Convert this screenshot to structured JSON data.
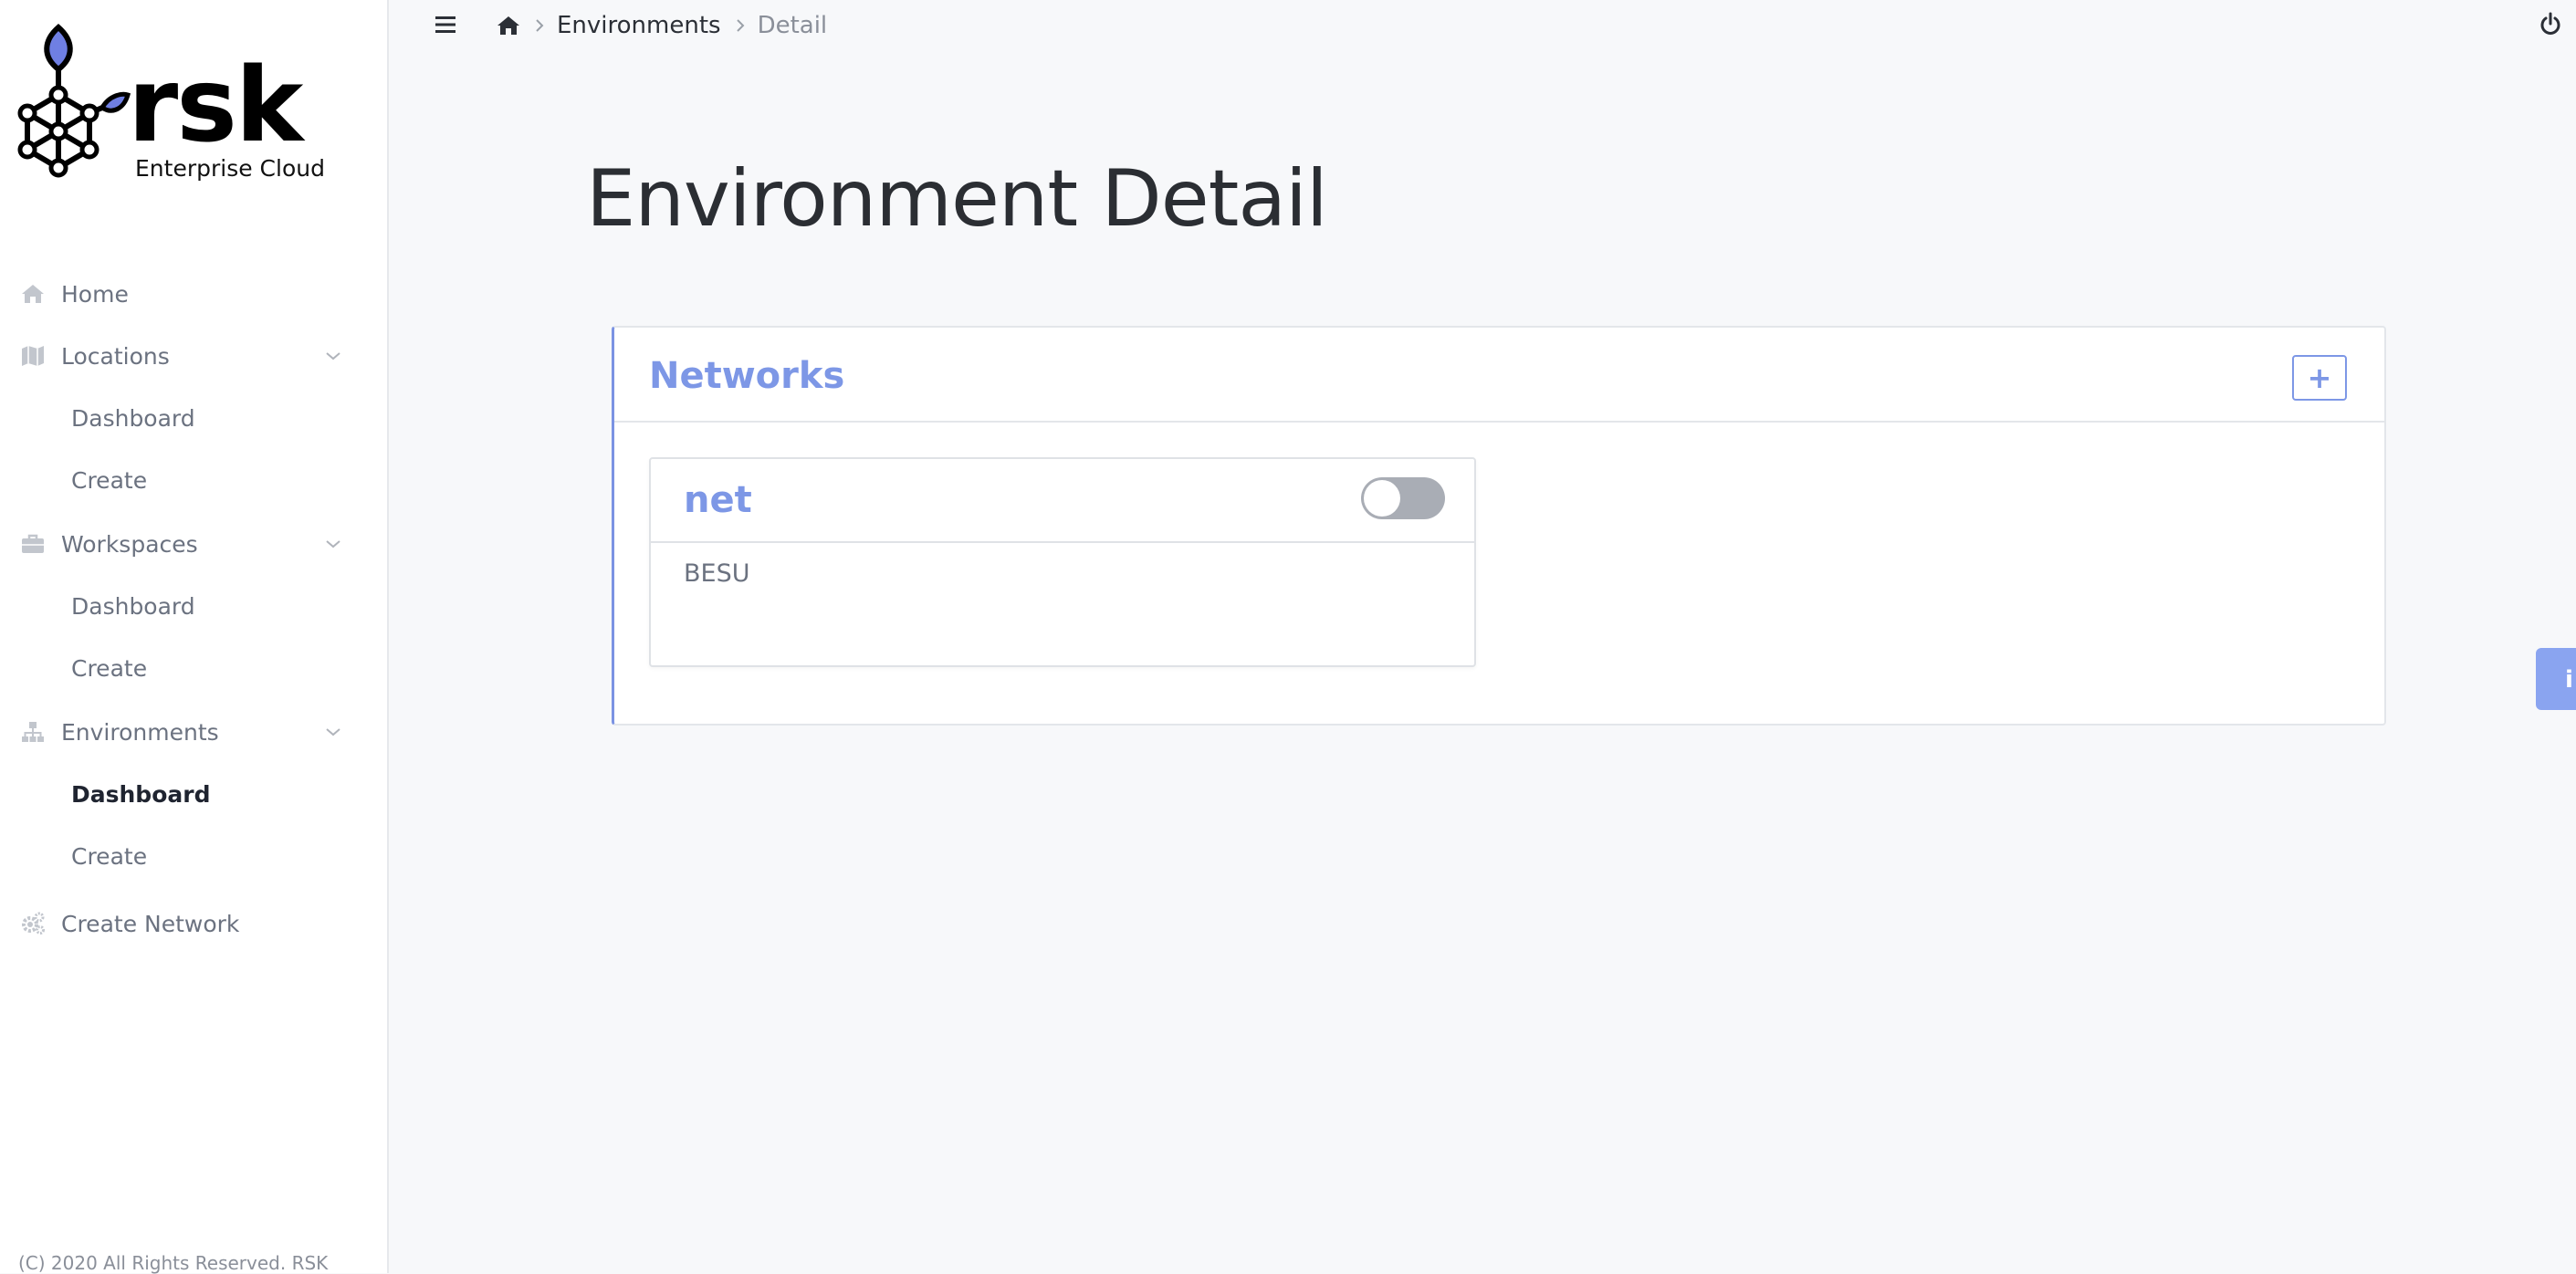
{
  "brand": {
    "name": "rsk",
    "subtitle": "Enterprise Cloud"
  },
  "sidebar": {
    "items": [
      {
        "label": "Home",
        "icon": "home-icon"
      },
      {
        "label": "Locations",
        "icon": "map-icon",
        "expanded": true,
        "children": [
          {
            "label": "Dashboard"
          },
          {
            "label": "Create"
          }
        ]
      },
      {
        "label": "Workspaces",
        "icon": "briefcase-icon",
        "expanded": true,
        "children": [
          {
            "label": "Dashboard"
          },
          {
            "label": "Create"
          }
        ]
      },
      {
        "label": "Environments",
        "icon": "sitemap-icon",
        "expanded": true,
        "children": [
          {
            "label": "Dashboard",
            "active": true
          },
          {
            "label": "Create"
          }
        ]
      },
      {
        "label": "Create Network",
        "icon": "cogs-icon"
      }
    ],
    "footer": "(C) 2020 All Rights Reserved. RSK"
  },
  "header": {
    "breadcrumb": [
      {
        "label": "Environments"
      },
      {
        "label": "Detail"
      }
    ]
  },
  "main": {
    "title": "Environment Detail",
    "panel": {
      "title": "Networks",
      "add_label": "+",
      "networks": [
        {
          "name": "net",
          "type": "BESU",
          "enabled": false
        }
      ]
    },
    "side_tab_label": "i"
  },
  "colors": {
    "accent": "#7d97e6",
    "toggle_off": "#a9adb5",
    "side_tab": "#8aa4f0"
  }
}
